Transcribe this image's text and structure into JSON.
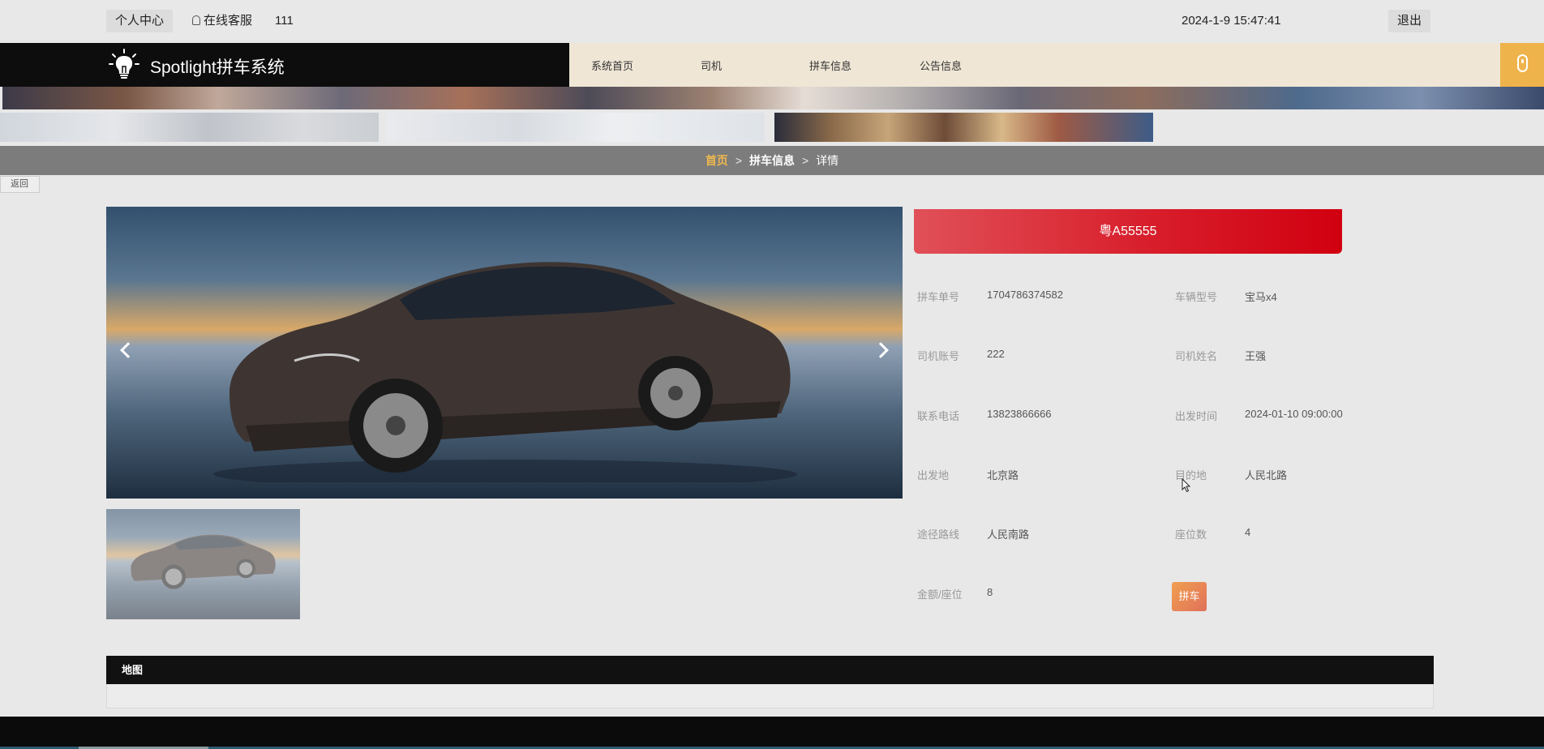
{
  "topbar": {
    "personal_center": "个人中心",
    "online_service": "在线客服",
    "username": "111",
    "datetime": "2024-1-9 15:47:41",
    "logout": "退出"
  },
  "header": {
    "brand": "Spotlight拼车系统",
    "nav": [
      "系统首页",
      "司机",
      "拼车信息",
      "公告信息"
    ]
  },
  "breadcrumb": {
    "home": "首页",
    "section": "拼车信息",
    "current": "详情",
    "sep": ">"
  },
  "back_label": "返回",
  "detail": {
    "plate": "粤A55555",
    "fields": [
      {
        "label": "拼车单号",
        "value": "1704786374582"
      },
      {
        "label": "车辆型号",
        "value": "宝马x4"
      },
      {
        "label": "司机账号",
        "value": "222"
      },
      {
        "label": "司机姓名",
        "value": "王强"
      },
      {
        "label": "联系电话",
        "value": "13823866666"
      },
      {
        "label": "出发时间",
        "value": "2024-01-10 09:00:00"
      },
      {
        "label": "出发地",
        "value": "北京路"
      },
      {
        "label": "目的地",
        "value": "人民北路"
      },
      {
        "label": "途径路线",
        "value": "人民南路"
      },
      {
        "label": "座位数",
        "value": "4"
      },
      {
        "label": "金额/座位",
        "value": "8"
      }
    ],
    "action_label": "拼车"
  },
  "map": {
    "title": "地图"
  },
  "colors": {
    "accent": "#efb34b",
    "plate_red": "#d81e2b",
    "breadcrumb_home": "#f0b94d"
  }
}
